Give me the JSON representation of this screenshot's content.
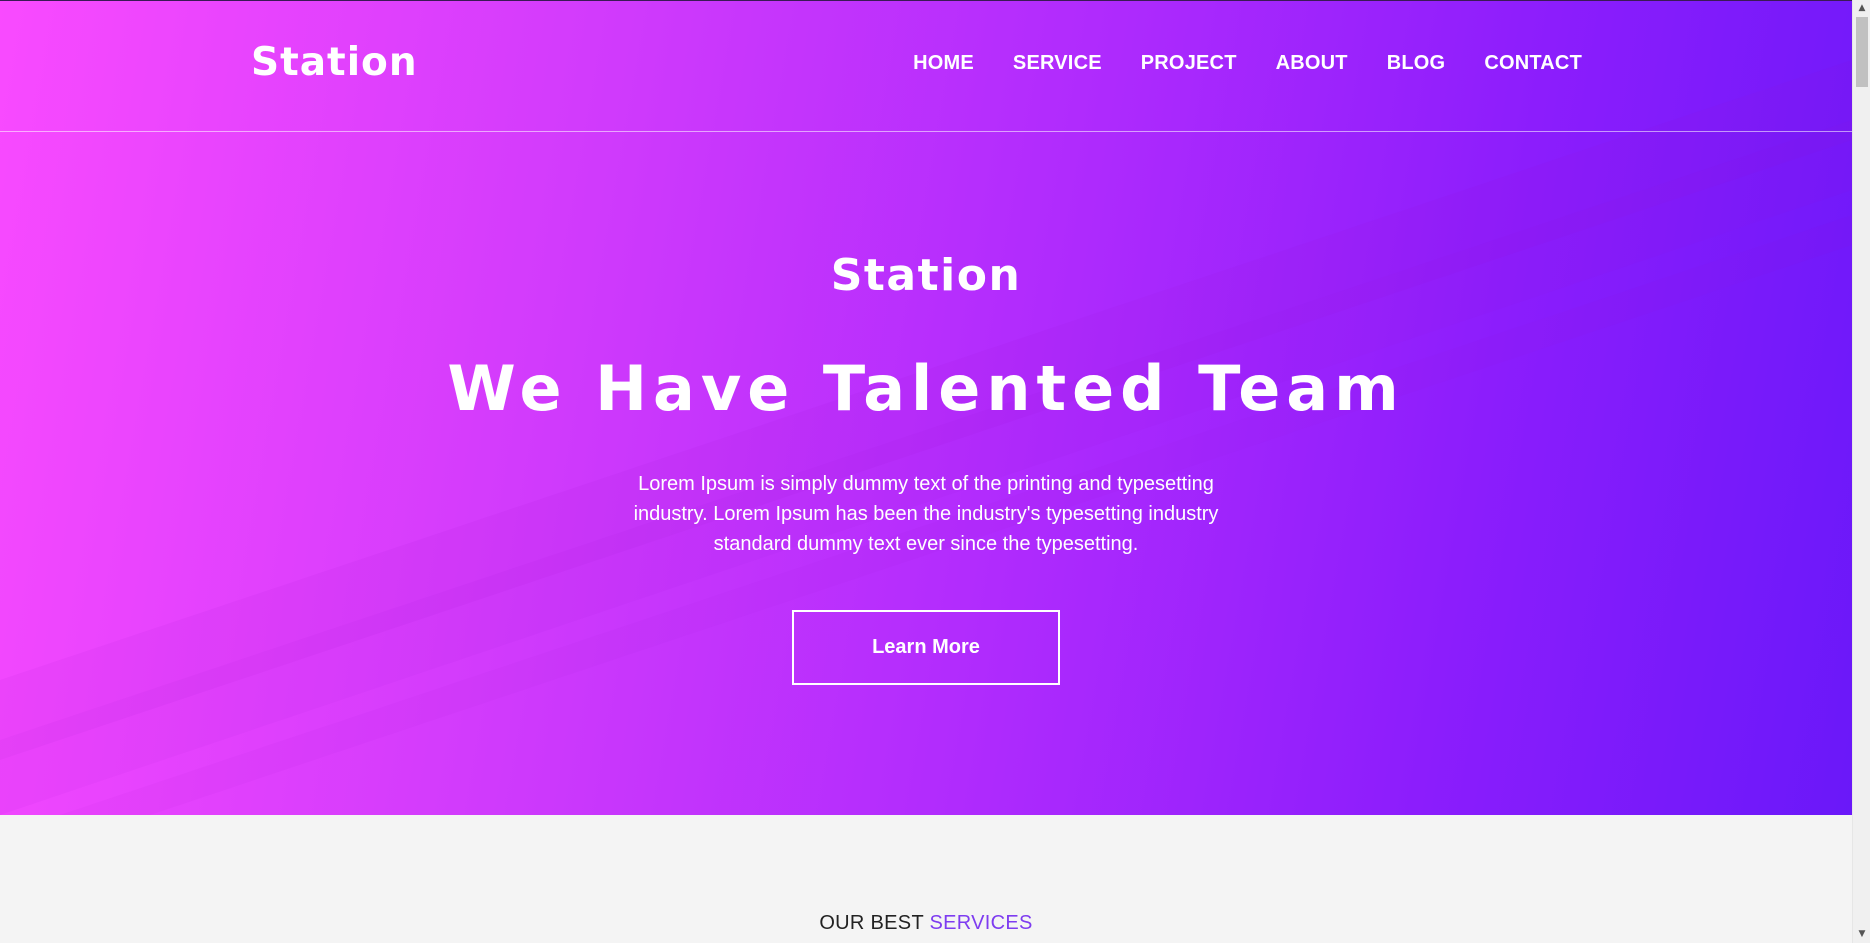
{
  "brand": "Station",
  "nav": {
    "items": [
      {
        "label": "HOME"
      },
      {
        "label": "SERVICE"
      },
      {
        "label": "PROJECT"
      },
      {
        "label": "ABOUT"
      },
      {
        "label": "BLOG"
      },
      {
        "label": "CONTACT"
      }
    ]
  },
  "hero": {
    "logo": "Station",
    "title": "We Have Talented Team",
    "text": "Lorem Ipsum is simply dummy text of the printing and typesetting industry. Lorem Ipsum has been the industry's typesetting industry standard dummy text ever since the typesetting.",
    "button_label": "Learn More"
  },
  "services": {
    "heading_prefix": "OUR BEST",
    "heading_accent": "SERVICES"
  },
  "colors": {
    "gradient_start": "#f94aff",
    "gradient_end": "#6a18f9",
    "accent": "#7e3cf0"
  },
  "icons": {
    "scroll_up": "chevron-up-icon",
    "scroll_down": "chevron-down-icon"
  }
}
